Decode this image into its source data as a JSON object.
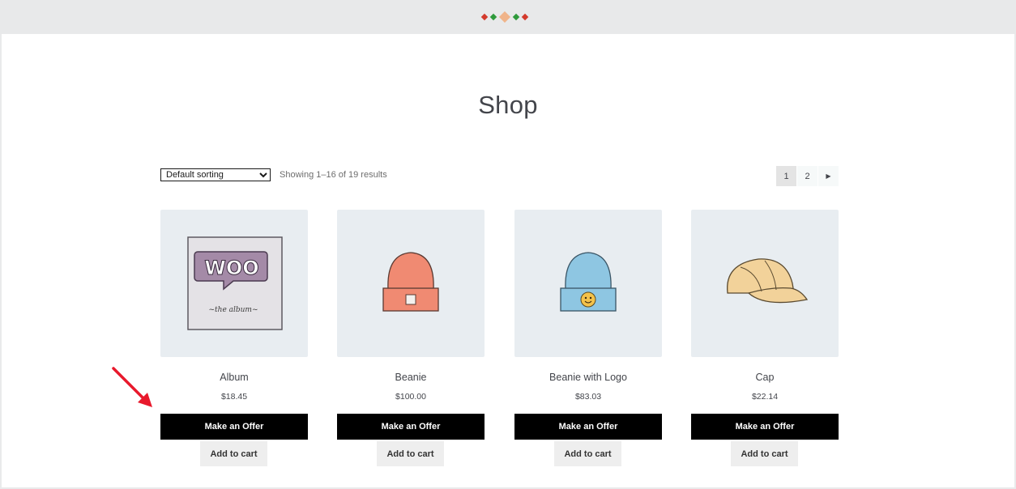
{
  "page": {
    "title": "Shop"
  },
  "toolbar": {
    "sorting_selected": "Default sorting",
    "results_count": "Showing 1–16 of 19 results"
  },
  "pagination": {
    "pages": [
      "1",
      "2"
    ],
    "current": "1",
    "next_icon": "triangle-right-icon"
  },
  "products": [
    {
      "name": "Album",
      "price": "$18.45",
      "offer_label": "Make an Offer",
      "cart_label": "Add to cart",
      "image": "woo-album-icon"
    },
    {
      "name": "Beanie",
      "price": "$100.00",
      "offer_label": "Make an Offer",
      "cart_label": "Add to cart",
      "image": "orange-beanie-icon"
    },
    {
      "name": "Beanie with Logo",
      "price": "$83.03",
      "offer_label": "Make an Offer",
      "cart_label": "Add to cart",
      "image": "blue-beanie-logo-icon"
    },
    {
      "name": "Cap",
      "price": "$22.14",
      "offer_label": "Make an Offer",
      "cart_label": "Add to cart",
      "image": "cap-icon"
    }
  ],
  "colors": {
    "offer_button_bg": "#000000",
    "cart_button_bg": "#eeeeee",
    "thumb_bg": "#e8edf1",
    "annotation_arrow": "#e8192c"
  }
}
